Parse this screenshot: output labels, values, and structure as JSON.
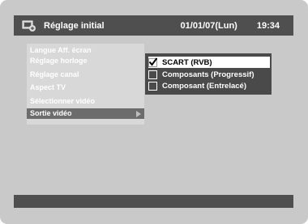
{
  "header": {
    "title": "Réglage initial",
    "date": "01/01/07(Lun)",
    "time": "19:34",
    "icon": "setup-icon"
  },
  "menu": {
    "items": [
      {
        "label": "Langue Aff. écran",
        "state": "disabled"
      },
      {
        "label": "Réglage horloge",
        "state": "disabled"
      },
      {
        "label": "Réglage canal",
        "state": "disabled"
      },
      {
        "label": "Aspect TV",
        "state": "disabled"
      },
      {
        "label": "Sélectionner vidéo",
        "state": "disabled"
      },
      {
        "label": "Sortie vidéo",
        "state": "selected",
        "arrow": "chevron-right-icon"
      }
    ]
  },
  "submenu": {
    "options": [
      {
        "label": "SCART (RVB)",
        "checked": true,
        "highlighted": true
      },
      {
        "label": "Composants (Progressif)",
        "checked": false,
        "highlighted": false
      },
      {
        "label": "Composant (Entrelacé)",
        "checked": false,
        "highlighted": false
      }
    ]
  },
  "colors": {
    "bar": "#4f4f4f",
    "background": "#c9c9c9",
    "highlight": "#ffffff"
  }
}
